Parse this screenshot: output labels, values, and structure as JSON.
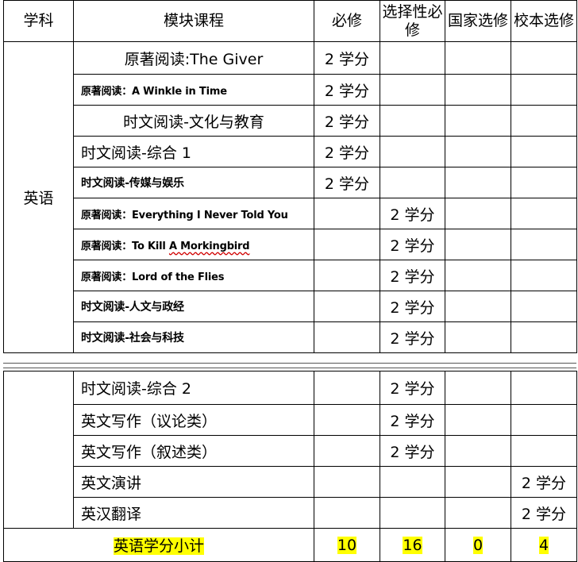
{
  "header": {
    "subject": "学科",
    "course": "模块课程",
    "required": "必修",
    "elective_required": "选择性必修",
    "national_elective": "国家选修",
    "school_elective": "校本选修"
  },
  "subject": "英语",
  "rows_top": [
    {
      "course": "原著阅读:The Giver",
      "required": "2 学分",
      "elective": "",
      "national": "",
      "school": ""
    },
    {
      "course": "原著阅读：A Winkle in Time",
      "required": "2 学分",
      "elective": "",
      "national": "",
      "school": ""
    },
    {
      "course": "时文阅读-文化与教育",
      "required": "2 学分",
      "elective": "",
      "national": "",
      "school": ""
    },
    {
      "course": "时文阅读-综合 1",
      "required": "2 学分",
      "elective": "",
      "national": "",
      "school": ""
    },
    {
      "course": "时文阅读-传媒与娱乐",
      "required": "2 学分",
      "elective": "",
      "national": "",
      "school": ""
    },
    {
      "course": "原著阅读：Everything I Never Told You",
      "required": "",
      "elective": "2 学分",
      "national": "",
      "school": ""
    },
    {
      "course_prefix": "原著阅读：To Kill ",
      "course_squiggle": "A Morkingbird",
      "required": "",
      "elective": "2 学分",
      "national": "",
      "school": ""
    },
    {
      "course": "原著阅读：Lord of the Flies",
      "required": "",
      "elective": "2 学分",
      "national": "",
      "school": ""
    },
    {
      "course": "时文阅读-人文与政经",
      "required": "",
      "elective": "2 学分",
      "national": "",
      "school": ""
    },
    {
      "course": "时文阅读-社会与科技",
      "required": "",
      "elective": "2 学分",
      "national": "",
      "school": ""
    }
  ],
  "rows_bottom": [
    {
      "course": "时文阅读-综合 2",
      "required": "",
      "elective": "2 学分",
      "national": "",
      "school": ""
    },
    {
      "course": "英文写作（议论类）",
      "required": "",
      "elective": "2 学分",
      "national": "",
      "school": ""
    },
    {
      "course": "英文写作（叙述类）",
      "required": "",
      "elective": "2 学分",
      "national": "",
      "school": ""
    },
    {
      "course": "英文演讲",
      "required": "",
      "elective": "",
      "national": "",
      "school": "2 学分"
    },
    {
      "course": "英汉翻译",
      "required": "",
      "elective": "",
      "national": "",
      "school": "2 学分"
    }
  ],
  "subtotal": {
    "label": "英语学分小计",
    "required": "10",
    "elective": "16",
    "national": "0",
    "school": "4"
  },
  "highlight_color": "#ffff00",
  "squiggle_color": "#d00000"
}
